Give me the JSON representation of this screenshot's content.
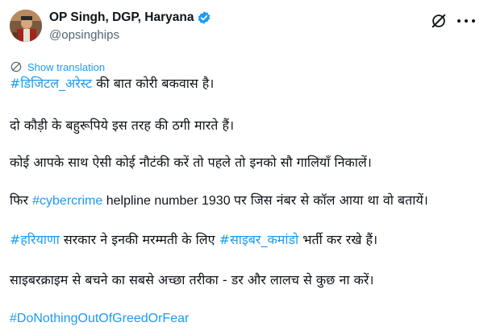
{
  "author": {
    "display_name": "OP Singh, DGP, Haryana",
    "handle": "@opsinghips",
    "verified_color": "#1d9bf0"
  },
  "translation": {
    "label": "Show translation"
  },
  "post": {
    "line1": {
      "tag": "#डिजिटल_अरेस्ट",
      "text": " की बात कोरी बकवास है।"
    },
    "line2": {
      "text": "दो कौड़ी के बहुरूपिये इस तरह की ठगी मारते हैं।"
    },
    "line3": {
      "text": "कोई आपके साथ ऐसी कोई नौटंकी करें तो पहले तो इनको सौ गालियाँ निकालें।"
    },
    "line4": {
      "pre": "फिर ",
      "tag": "#cybercrime",
      "mid": " helpline number 1930 ",
      "post": "पर जिस नंबर से कॉल आया था वो बतायें।"
    },
    "line5": {
      "tag1": "#हरियाणा",
      "mid": " सरकार ने इनकी मरम्मती के लिए ",
      "tag2": "#साइबर_कमांडो",
      "post": " भर्ती कर रखे हैं।"
    },
    "line6": {
      "text": "साइबरक्राइम से बचने का सबसे अच्छा तरीका - डर और लालच से कुछ ना करें।"
    },
    "line7": {
      "tag": "#DoNothingOutOfGreedOrFear"
    }
  },
  "icons": {
    "avatar": "profile-photo",
    "verified": "verified-badge-icon",
    "grok": "grok-icon",
    "more": "more-icon",
    "translate": "translate-icon"
  },
  "colors": {
    "text": "#0f1419",
    "secondary": "#536471",
    "link": "#1d9bf0"
  }
}
